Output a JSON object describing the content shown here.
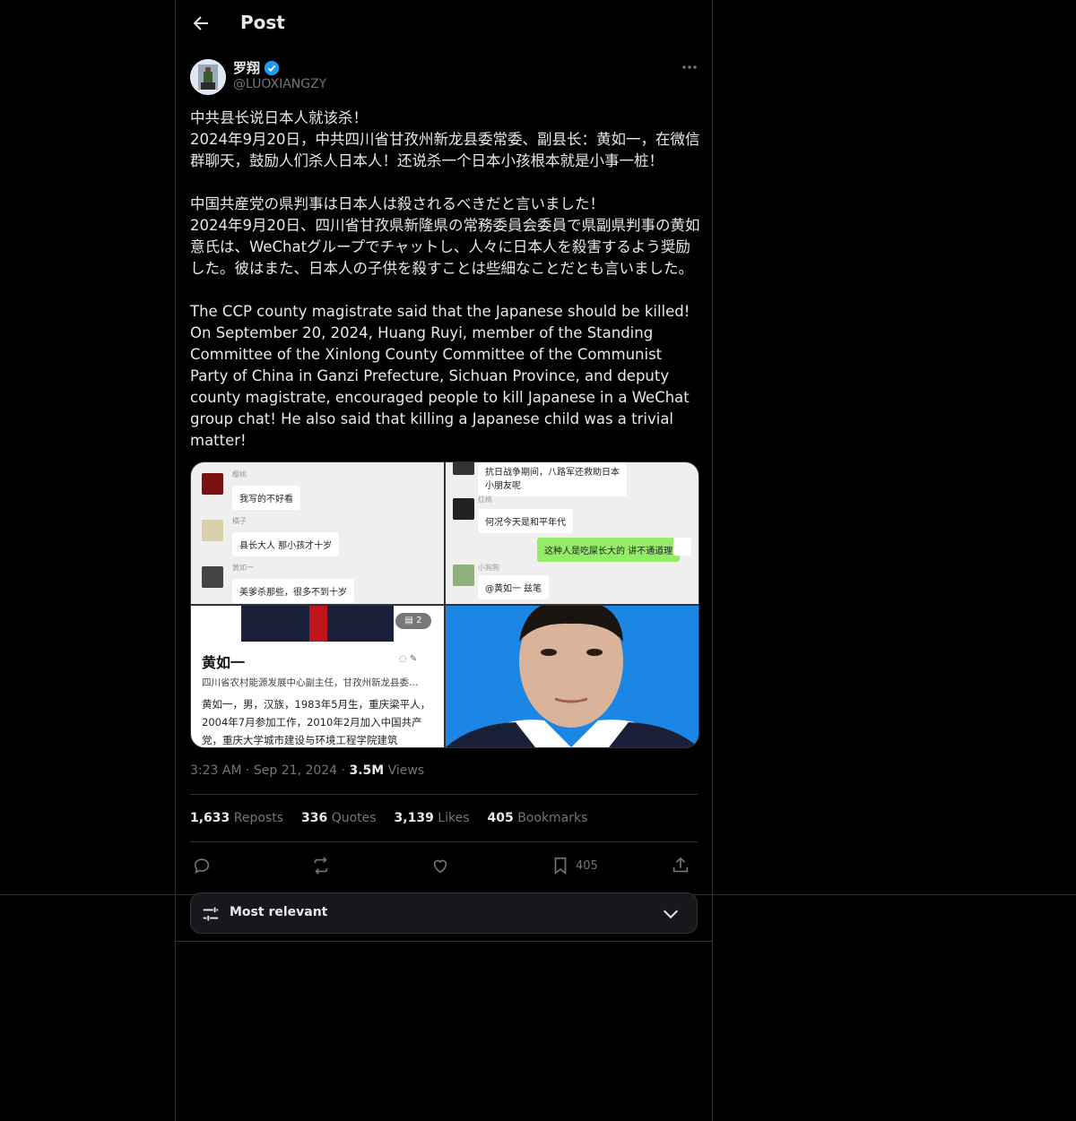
{
  "header": {
    "title": "Post"
  },
  "author": {
    "name": "罗翔",
    "handle": "@LUOXIANGZY",
    "verified": true
  },
  "tweet": {
    "text": "中共县长说日本人就该杀！\n2024年9月20日，中共四川省甘孜州新龙县委常委、副县长：黄如一，在微信群聊天，鼓励人们杀人日本人！还说杀一个日本小孩根本就是小事一桩！\n\n中国共産党の県判事は日本人は殺されるべきだと言いました！\n2024年9月20日、四川省甘孜県新隆県の常務委員会委員で県副県判事の黄如意氏は、WeChatグループでチャットし、人々に日本人を殺害するよう奨励した。彼はまた、日本人の子供を殺すことは些細なことだとも言いました。\n\nThe CCP county magistrate said that the Japanese should be killed!\nOn September 20, 2024, Huang Ruyi, member of the Standing Committee of the Xinlong County Committee of the Communist Party of China in Ganzi Prefecture, Sichuan Province, and deputy county magistrate, encouraged people to kill Japanese in a WeChat group chat! He also said that killing a Japanese child was a trivial matter!"
  },
  "media": {
    "chat1": {
      "names": [
        "樱桃",
        "橘子",
        "黄如一"
      ],
      "messages": [
        "我写的不好看",
        "县长大人 那小孩才十岁",
        "美爹杀那些，很多不到十岁"
      ]
    },
    "chat2": {
      "top_message": "抗日战争期间，八路军还救助日本小朋友呢",
      "names": [
        "红桃",
        "小狗狗"
      ],
      "messages": [
        "何况今天是和平年代",
        "@黄如一 兹笔"
      ],
      "green_message": "这种人是吃屎长大的  讲不通道理"
    },
    "profile": {
      "badge_count": "2",
      "name": "黄如一",
      "subtitle": "四川省农村能源发展中心副主任，甘孜州新龙县委…",
      "bio": "黄如一，男，汉族，1983年5月生，重庆梁平人，2004年7月参加工作，2010年2月加入中国共产党，重庆大学城市建设与环境工程学院建筑"
    }
  },
  "meta": {
    "time": "3:23 AM",
    "date": "Sep 21, 2024",
    "views_count": "3.5M",
    "views_label": "Views"
  },
  "stats": [
    {
      "count": "1,633",
      "label": "Reposts"
    },
    {
      "count": "336",
      "label": "Quotes"
    },
    {
      "count": "3,139",
      "label": "Likes"
    },
    {
      "count": "405",
      "label": "Bookmarks"
    }
  ],
  "actions": {
    "bookmark_count": "405"
  },
  "sort": {
    "label": "Most relevant"
  },
  "colors": {
    "accent": "#1d9bf0",
    "border": "#2f3336",
    "muted": "#71767b",
    "wechat_green": "#95ec69"
  }
}
